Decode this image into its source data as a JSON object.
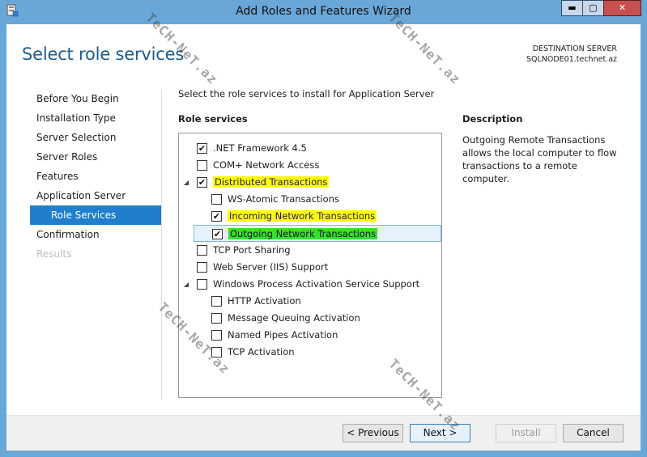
{
  "window": {
    "title": "Add Roles and Features Wizard",
    "min": "▬",
    "max": "▢",
    "close": "✕",
    "app_icon": "server-manager-icon"
  },
  "header": {
    "page_title": "Select role services",
    "destination_label": "DESTINATION SERVER",
    "destination_server": "SQLNODE01.technet.az"
  },
  "nav": {
    "items": [
      {
        "label": "Before You Begin",
        "state": "normal"
      },
      {
        "label": "Installation Type",
        "state": "normal"
      },
      {
        "label": "Server Selection",
        "state": "normal"
      },
      {
        "label": "Server Roles",
        "state": "normal"
      },
      {
        "label": "Features",
        "state": "normal"
      },
      {
        "label": "Application Server",
        "state": "normal"
      },
      {
        "label": "Role Services",
        "state": "active"
      },
      {
        "label": "Confirmation",
        "state": "normal"
      },
      {
        "label": "Results",
        "state": "disabled"
      }
    ]
  },
  "main": {
    "intro": "Select the role services to install for Application Server",
    "role_services_heading": "Role services",
    "tree": [
      {
        "label": ".NET Framework 4.5",
        "checked": true,
        "indent": 1,
        "expander": ""
      },
      {
        "label": "COM+ Network Access",
        "checked": false,
        "indent": 1,
        "expander": ""
      },
      {
        "label": "Distributed Transactions",
        "checked": true,
        "indent": 1,
        "expander": "◢",
        "highlight": "yellow"
      },
      {
        "label": "WS-Atomic Transactions",
        "checked": false,
        "indent": 2,
        "expander": ""
      },
      {
        "label": "Incoming Network Transactions",
        "checked": true,
        "indent": 2,
        "expander": "",
        "highlight": "yellow"
      },
      {
        "label": "Outgoing Network Transactions",
        "checked": true,
        "indent": 2,
        "expander": "",
        "highlight": "green",
        "selected": true
      },
      {
        "label": "TCP Port Sharing",
        "checked": false,
        "indent": 1,
        "expander": ""
      },
      {
        "label": "Web Server (IIS) Support",
        "checked": false,
        "indent": 1,
        "expander": ""
      },
      {
        "label": "Windows Process Activation Service Support",
        "checked": false,
        "indent": 1,
        "expander": "◢"
      },
      {
        "label": "HTTP Activation",
        "checked": false,
        "indent": 2,
        "expander": ""
      },
      {
        "label": "Message Queuing Activation",
        "checked": false,
        "indent": 2,
        "expander": ""
      },
      {
        "label": "Named Pipes Activation",
        "checked": false,
        "indent": 2,
        "expander": ""
      },
      {
        "label": "TCP Activation",
        "checked": false,
        "indent": 2,
        "expander": ""
      }
    ],
    "description_heading": "Description",
    "description_text": "Outgoing Remote Transactions allows the local computer to flow transactions to a remote computer."
  },
  "footer": {
    "previous": "< Previous",
    "next": "Next >",
    "install": "Install",
    "cancel": "Cancel"
  },
  "watermark": {
    "text": "TeCH-NeT.az"
  }
}
